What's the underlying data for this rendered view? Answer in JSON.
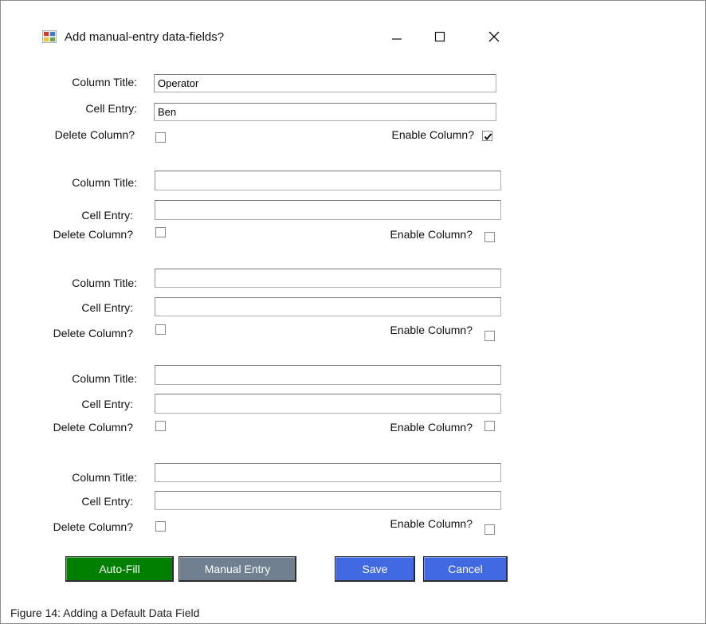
{
  "window": {
    "title": "Add manual-entry data-fields?",
    "controls": {
      "minimize": "—",
      "maximize": "☐",
      "close": "✕"
    }
  },
  "labels": {
    "column_title": "Column Title:",
    "cell_entry": "Cell Entry:",
    "delete_column": "Delete Column?",
    "enable_column": "Enable Column?"
  },
  "fields": [
    {
      "column_title": "Operator",
      "cell_entry": "Ben",
      "delete": false,
      "enable": true
    },
    {
      "column_title": "",
      "cell_entry": "",
      "delete": false,
      "enable": false
    },
    {
      "column_title": "",
      "cell_entry": "",
      "delete": false,
      "enable": false
    },
    {
      "column_title": "",
      "cell_entry": "",
      "delete": false,
      "enable": false
    },
    {
      "column_title": "",
      "cell_entry": "",
      "delete": false,
      "enable": false
    }
  ],
  "buttons": {
    "auto_fill": "Auto-Fill",
    "manual_entry": "Manual Entry",
    "save": "Save",
    "cancel": "Cancel"
  },
  "colors": {
    "auto_fill": "#008000",
    "manual_entry": "#708090",
    "save": "#4169e1",
    "cancel": "#4169e1"
  },
  "caption": {
    "label": "Figure 14:",
    "text": "Adding a Default Data Field"
  }
}
